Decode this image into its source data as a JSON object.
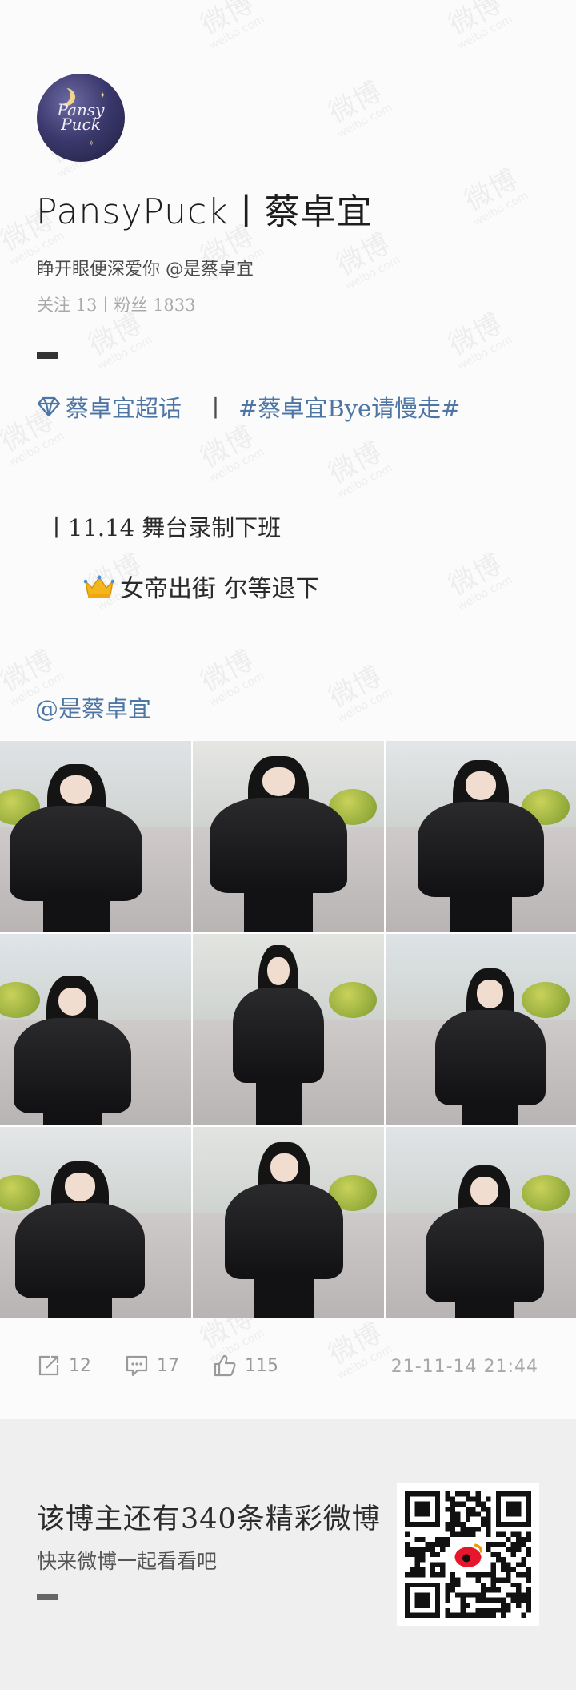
{
  "watermark": {
    "text": "微博",
    "sub": "weibo.com"
  },
  "profile": {
    "avatar_text": "Pansy Puck",
    "title": "PansyPuck丨蔡卓宜",
    "bio": "睁开眼便深爱你 @是蔡卓宜",
    "stats": "关注 13丨粉丝 1833"
  },
  "post": {
    "topics": [
      "蔡卓宜超话",
      "丨",
      "#蔡卓宜Bye请慢走#"
    ],
    "line1": "丨11.14 舞台录制下班",
    "line2": "女帝出街 尔等退下",
    "mention": "@是蔡卓宜",
    "photo_count": 9
  },
  "actions": {
    "reposts": "12",
    "comments": "17",
    "likes": "115",
    "time": "21-11-14 21:44"
  },
  "footer": {
    "cta1": "该博主还有340条精彩微博",
    "cta2": "快来微博一起看看吧"
  },
  "colors": {
    "link": "#4d76a5",
    "background": "#fbfbfb",
    "footer": "#efefef"
  },
  "icons": [
    "repost-icon",
    "comment-icon",
    "like-icon",
    "diamond-icon",
    "crown-icon",
    "qr-code",
    "weibo-logo"
  ]
}
